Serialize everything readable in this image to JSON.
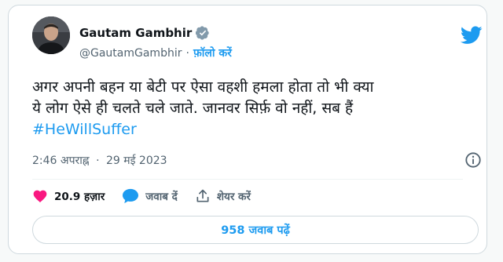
{
  "author": {
    "name": "Gautam Gambhir",
    "handle": "@GautamGambhir",
    "separator": "·",
    "follow_label": "फ़ॉलो करें",
    "verified_icon": "verified-badge-icon",
    "avatar_icon": "profile-avatar"
  },
  "brand": {
    "logo_icon": "twitter-bird-icon",
    "color": "#1d9bf0"
  },
  "tweet": {
    "line1": "अगर अपनी बहन या बेटी पर ऐसा वहशी हमला होता तो भी क्या",
    "line2": "ये लोग ऐसे ही चलते चले जाते. जानवर सिर्फ़ वो नहीं, सब हैं",
    "hashtag": "#HeWillSuffer"
  },
  "meta": {
    "time": "2:46 अपराह्न",
    "separator": "·",
    "date": "29 मई 2023",
    "info_icon": "info-icon"
  },
  "actions": {
    "like": {
      "icon": "heart-icon",
      "count": "20.9 हज़ार",
      "color": "#f91880"
    },
    "reply": {
      "icon": "reply-bubble-icon",
      "label": "जवाब दें"
    },
    "share": {
      "icon": "share-icon",
      "label": "शेयर करें"
    }
  },
  "replies_button": {
    "label": "958 जवाब पढ़ें"
  }
}
